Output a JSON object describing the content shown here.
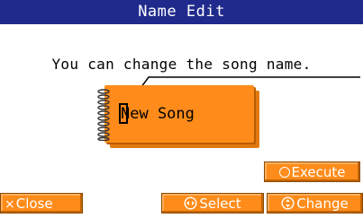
{
  "window": {
    "title": "Name Edit"
  },
  "message": "You can change the song name.",
  "name_field": {
    "value": "New Song"
  },
  "buttons": {
    "execute": "Execute",
    "close": "Close",
    "select": "Select",
    "change": "Change"
  },
  "icons": {
    "execute": "circle-icon",
    "close": "x-icon",
    "select": "dial-left-right-icon",
    "change": "dial-up-down-icon"
  },
  "colors": {
    "title_bar": "#1f2a8c",
    "button": "#ff8c1a",
    "notebook": "#ff8c1a"
  }
}
